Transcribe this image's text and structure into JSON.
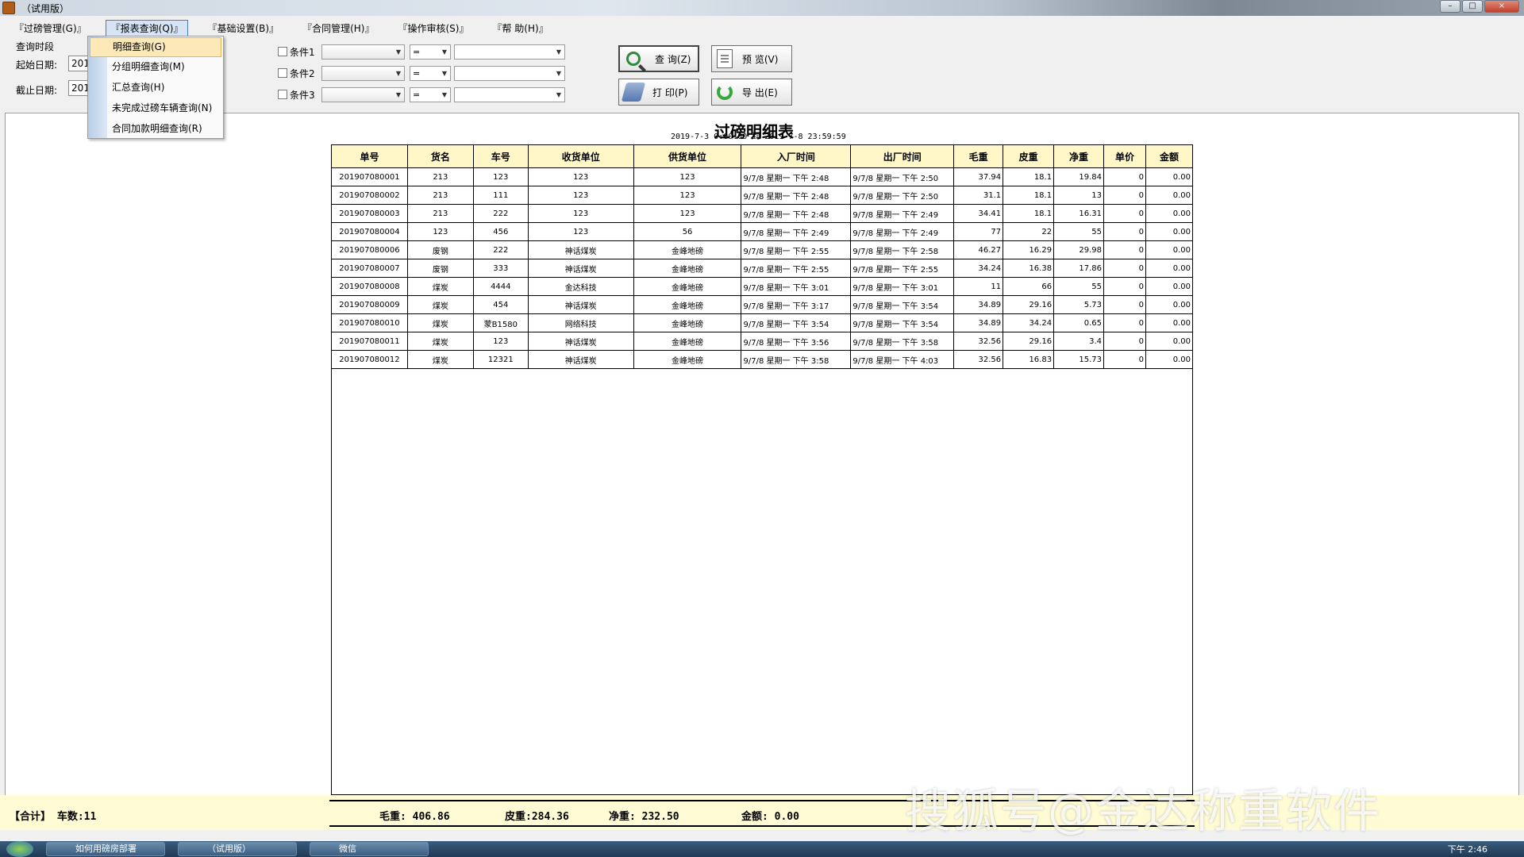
{
  "window": {
    "title": "（试用版）"
  },
  "menu": [
    "『过磅管理(G)』",
    "『报表查询(Q)』",
    "『基础设置(B)』",
    "『合同管理(H)』",
    "『操作审核(S)』",
    "『帮 助(H)』"
  ],
  "dropdown": [
    "明细查询(G)",
    "分组明细查询(M)",
    "汇总查询(H)",
    "未完成过磅车辆查询(N)",
    "合同加款明细查询(R)"
  ],
  "query": {
    "period_label": "查询时段",
    "start_label": "起始日期:",
    "end_label": "截止日期:",
    "start_value": "201",
    "end_value": "201",
    "conditions": [
      {
        "label": "条件1",
        "op": "="
      },
      {
        "label": "条件2",
        "op": "="
      },
      {
        "label": "条件3",
        "op": "="
      }
    ]
  },
  "buttons": {
    "query": "查 询(Z)",
    "preview": "预 览(V)",
    "print": "打 印(P)",
    "export": "导 出(E)"
  },
  "report": {
    "title": "过磅明细表",
    "range": "2019-7-3  0:00:00  到 2019-7-8  23:59:59",
    "columns": [
      "单号",
      "货名",
      "车号",
      "收货单位",
      "供货单位",
      "入厂时间",
      "出厂时间",
      "毛重",
      "皮重",
      "净重",
      "单价",
      "金额"
    ],
    "rows": [
      [
        "201907080001",
        "213",
        "123",
        "123",
        "123",
        "9/7/8 星期一 下午 2:48",
        "9/7/8 星期一 下午 2:50",
        "37.94",
        "18.1",
        "19.84",
        "0",
        "0.00"
      ],
      [
        "201907080002",
        "213",
        "111",
        "123",
        "123",
        "9/7/8 星期一 下午 2:48",
        "9/7/8 星期一 下午 2:50",
        "31.1",
        "18.1",
        "13",
        "0",
        "0.00"
      ],
      [
        "201907080003",
        "213",
        "222",
        "123",
        "123",
        "9/7/8 星期一 下午 2:48",
        "9/7/8 星期一 下午 2:49",
        "34.41",
        "18.1",
        "16.31",
        "0",
        "0.00"
      ],
      [
        "201907080004",
        "123",
        "456",
        "123",
        "56",
        "9/7/8 星期一 下午 2:49",
        "9/7/8 星期一 下午 2:49",
        "77",
        "22",
        "55",
        "0",
        "0.00"
      ],
      [
        "201907080006",
        "废钢",
        "222",
        "神话煤炭",
        "金峰地磅",
        "9/7/8 星期一 下午 2:55",
        "9/7/8 星期一 下午 2:58",
        "46.27",
        "16.29",
        "29.98",
        "0",
        "0.00"
      ],
      [
        "201907080007",
        "废钢",
        "333",
        "神话煤炭",
        "金峰地磅",
        "9/7/8 星期一 下午 2:55",
        "9/7/8 星期一 下午 2:55",
        "34.24",
        "16.38",
        "17.86",
        "0",
        "0.00"
      ],
      [
        "201907080008",
        "煤炭",
        "4444",
        "金达科技",
        "金峰地磅",
        "9/7/8 星期一 下午 3:01",
        "9/7/8 星期一 下午 3:01",
        "11",
        "66",
        "55",
        "0",
        "0.00"
      ],
      [
        "201907080009",
        "煤炭",
        "454",
        "神话煤炭",
        "金峰地磅",
        "9/7/8 星期一 下午 3:17",
        "9/7/8 星期一 下午 3:54",
        "34.89",
        "29.16",
        "5.73",
        "0",
        "0.00"
      ],
      [
        "201907080010",
        "煤炭",
        "蒙B1580",
        "网络科技",
        "金峰地磅",
        "9/7/8 星期一 下午 3:54",
        "9/7/8 星期一 下午 3:54",
        "34.89",
        "34.24",
        "0.65",
        "0",
        "0.00"
      ],
      [
        "201907080011",
        "煤炭",
        "123",
        "神话煤炭",
        "金峰地磅",
        "9/7/8 星期一 下午 3:56",
        "9/7/8 星期一 下午 3:58",
        "32.56",
        "29.16",
        "3.4",
        "0",
        "0.00"
      ],
      [
        "201907080012",
        "煤炭",
        "12321",
        "神话煤炭",
        "金峰地磅",
        "9/7/8 星期一 下午 3:58",
        "9/7/8 星期一 下午 4:03",
        "32.56",
        "16.83",
        "15.73",
        "0",
        "0.00"
      ]
    ]
  },
  "footer": {
    "label": "【合计】 车数:11",
    "gross": "毛重: 406.86",
    "tare": "皮重:284.36",
    "net": "净重: 232.50",
    "amount": "金额: 0.00"
  },
  "watermark": "搜狐号@金达称重软件",
  "taskbar": {
    "items": [
      "如何用磅房部署",
      "（试用版）",
      "微信"
    ],
    "time": "下午 2:46"
  }
}
